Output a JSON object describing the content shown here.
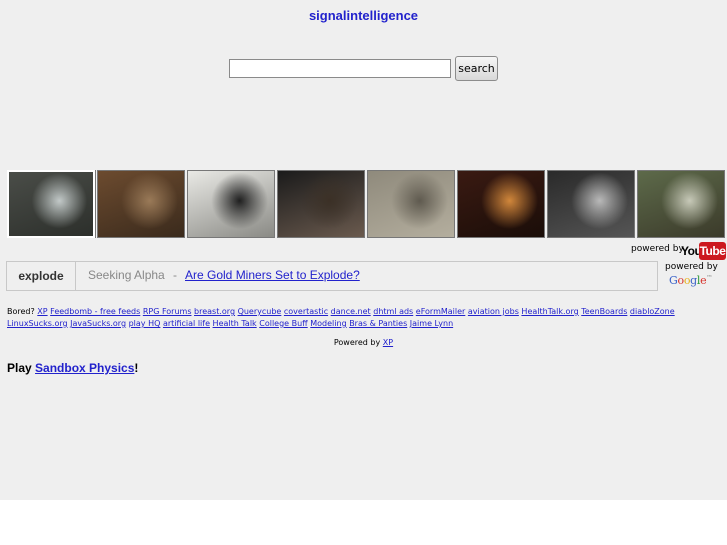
{
  "header": {
    "title": "signalintelligence"
  },
  "search": {
    "placeholder": "",
    "value": "",
    "button_label": "search"
  },
  "thumbnails": [
    {
      "name": "thumb-1",
      "colors": [
        "#4a4d48",
        "#c2c9c8",
        "#2c2f2b"
      ]
    },
    {
      "name": "thumb-2",
      "colors": [
        "#6c4b2f",
        "#9a7a58",
        "#3a2a1c"
      ]
    },
    {
      "name": "thumb-3",
      "colors": [
        "#e9e9e5",
        "#1f1f1f",
        "#8a8a85"
      ]
    },
    {
      "name": "thumb-4",
      "colors": [
        "#1b1b1b",
        "#3b3026",
        "#6a5a4e"
      ]
    },
    {
      "name": "thumb-5",
      "colors": [
        "#8f8a7c",
        "#5f5a4f",
        "#b4ae9e"
      ]
    },
    {
      "name": "thumb-6",
      "colors": [
        "#3a1a12",
        "#d1873b",
        "#1a0d08"
      ]
    },
    {
      "name": "thumb-7",
      "colors": [
        "#2a2a2a",
        "#b9b9b9",
        "#555555"
      ]
    },
    {
      "name": "thumb-8",
      "colors": [
        "#5d6a4a",
        "#c7c9b8",
        "#3b3a2a"
      ]
    }
  ],
  "youtube": {
    "powered_by": "powered by",
    "logo_you": "You",
    "logo_tube": "Tube"
  },
  "news": {
    "keyword": "explode",
    "source": "Seeking Alpha",
    "separator": "-",
    "headline": "Are Gold Miners Set to Explode?"
  },
  "google": {
    "powered_by": "powered by",
    "logo": "Google™"
  },
  "links": {
    "prefix": "Bored?",
    "items": [
      "XP",
      "Feedbomb - free feeds",
      "RPG Forums",
      "breast.org",
      "Querycube",
      "covertastic",
      "dance.net",
      "dhtml ads",
      "eFormMailer",
      "aviation jobs",
      "HealthTalk.org",
      "TeenBoards",
      "diabloZone",
      "LinuxSucks.org",
      "JavaSucks.org",
      "play HQ",
      "artificial life",
      "Health Talk",
      "College Buff",
      "Modeling",
      "Bras & Panties",
      "Jaime Lynn"
    ]
  },
  "footer": {
    "powered_by": "Powered by",
    "xp_link": "XP"
  },
  "play": {
    "prefix": "Play",
    "link": "Sandbox Physics",
    "suffix": "!"
  },
  "colors": {
    "link": "#2222cc",
    "background": "#efefef",
    "youtube_red": "#cc181e"
  }
}
